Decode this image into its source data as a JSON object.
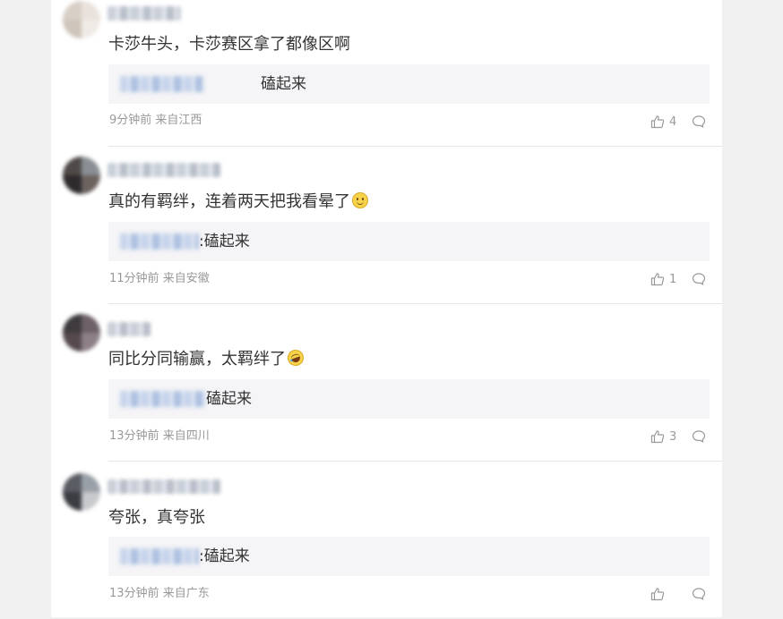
{
  "comments": [
    {
      "content": "卡莎牛头，卡莎赛区拿了都像区啊",
      "reply_text": "磕起来",
      "time": "9分钟前",
      "region": "来自江西",
      "likes": "4",
      "emoji": "",
      "avatar_colors": [
        "#d8cfc6",
        "#e9e2dc",
        "#cfc5ba",
        "#efeae5"
      ]
    },
    {
      "content": "真的有羁绊，连着两天把我看晕了",
      "reply_text": ":磕起来",
      "time": "11分钟前",
      "region": "来自安徽",
      "likes": "1",
      "emoji": "smile",
      "avatar_colors": [
        "#4f4a48",
        "#8a8f95",
        "#2e2b2d",
        "#6b625e"
      ]
    },
    {
      "content": "同比分同输赢，太羁绊了",
      "reply_text": "磕起来",
      "time": "13分钟前",
      "region": "来自四川",
      "likes": "3",
      "emoji": "laugh",
      "avatar_colors": [
        "#3e3a3d",
        "#6d6167",
        "#55494e",
        "#8d8087"
      ]
    },
    {
      "content": "夸张，真夸张",
      "reply_text": ":磕起来",
      "time": "13分钟前",
      "region": "来自广东",
      "likes": "",
      "emoji": "",
      "avatar_colors": [
        "#5a5c63",
        "#9aa0a8",
        "#3b3d42",
        "#c7c9cc"
      ]
    }
  ],
  "icons": {
    "like": "thumbs-up-icon",
    "reply": "speech-bubble-icon"
  },
  "colors": {
    "meta": "#999999",
    "reply_bg": "#f5f5f7",
    "text": "#333333"
  }
}
